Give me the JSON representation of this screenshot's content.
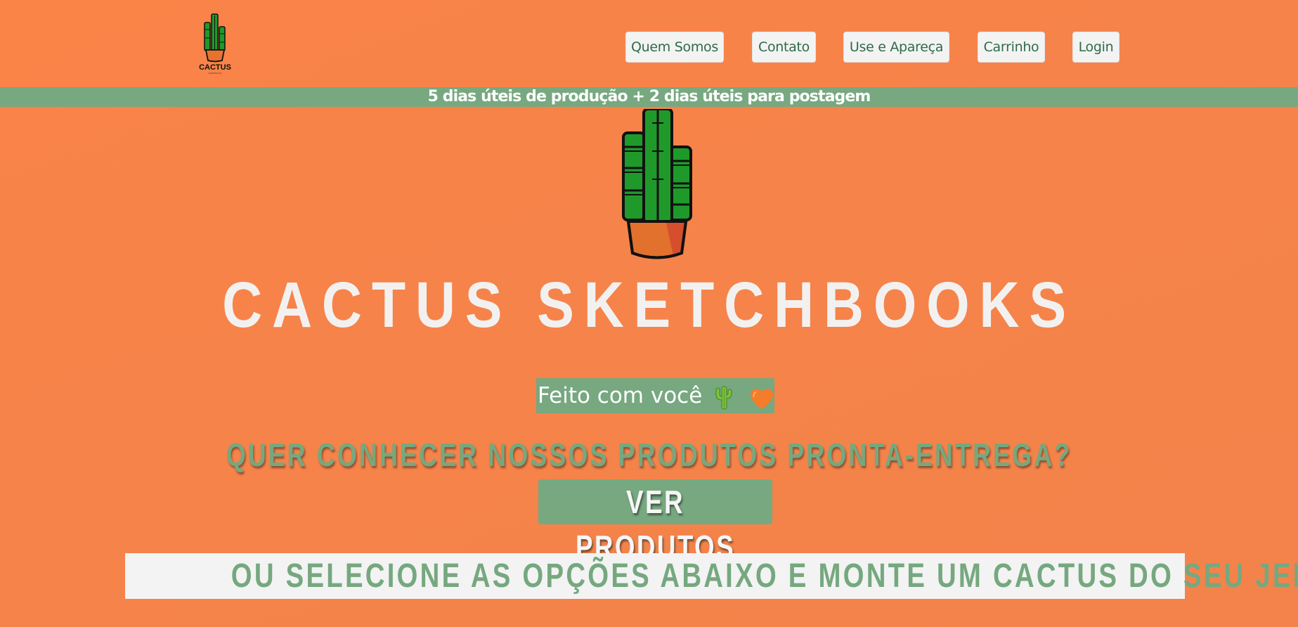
{
  "header": {
    "logo_icon": "cactus-logo-icon",
    "logo_text": "CACTUS",
    "nav": [
      {
        "label": "Quem Somos"
      },
      {
        "label": "Contato"
      },
      {
        "label": "Use e Apareça"
      },
      {
        "label": "Carrinho"
      },
      {
        "label": "Login"
      }
    ]
  },
  "banner": {
    "text": "5 dias úteis de produção + 2 dias úteis para postagem"
  },
  "hero": {
    "cactus_icon": "cactus-pot-icon",
    "title": "CACTUS SKETCHBOOKS",
    "tagline": "Feito com você",
    "tagline_emojis": [
      "cactus-emoji-icon",
      "orange-heart-icon"
    ],
    "question": "QUER CONHECER NOSSOS PRODUTOS PRONTA-ENTREGA?",
    "cta_label": "VER PRODUTOS",
    "select_prompt": "OU SELECIONE AS OPÇÕES ABAIXO E MONTE UM CACTUS DO SEU JEITO!"
  },
  "colors": {
    "background": "#f5834a",
    "accent_green": "#77a880",
    "nav_text": "#2f6b47",
    "light": "#f3f3f3"
  }
}
